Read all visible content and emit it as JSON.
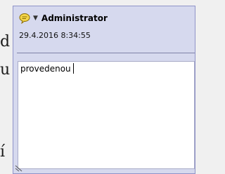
{
  "background_letters": [
    "d",
    "u",
    "í"
  ],
  "note": {
    "author": "Administrator",
    "timestamp": "29.4.2016 8:34:55",
    "text": "provedenou",
    "icon": "comment-bubble-icon",
    "dropdown_icon": "chevron-down-icon"
  },
  "colors": {
    "popup_background": "#d6d9ee",
    "popup_border": "#8f93c8",
    "icon_fill": "#f5d64a",
    "text_background": "#ffffff"
  }
}
